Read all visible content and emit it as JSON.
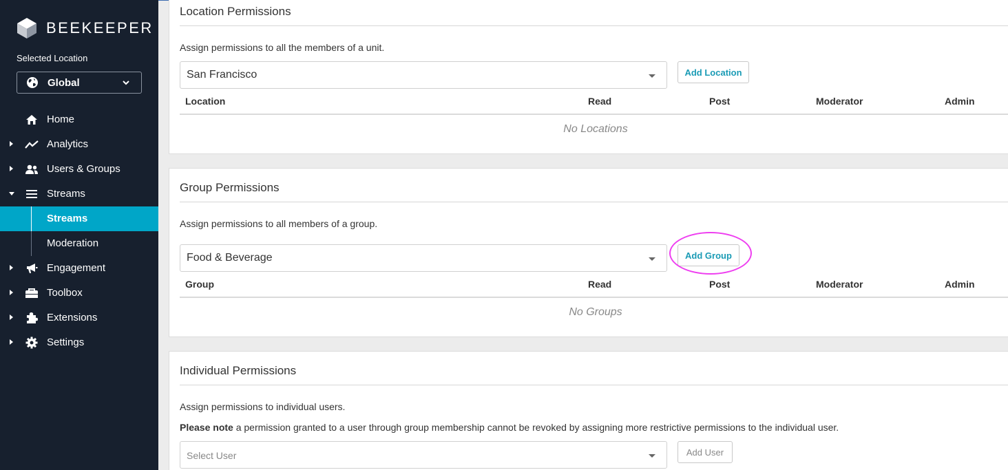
{
  "sidebar": {
    "logo_text": "BEEKEEPER",
    "selected_location_label": "Selected Location",
    "location_value": "Global",
    "nav": [
      {
        "label": "Home",
        "icon": "home-icon"
      },
      {
        "label": "Analytics",
        "icon": "analytics-icon"
      },
      {
        "label": "Users & Groups",
        "icon": "users-icon"
      },
      {
        "label": "Streams",
        "icon": "list-icon"
      },
      {
        "label": "Engagement",
        "icon": "megaphone-icon"
      },
      {
        "label": "Toolbox",
        "icon": "toolbox-icon"
      },
      {
        "label": "Extensions",
        "icon": "puzzle-icon"
      },
      {
        "label": "Settings",
        "icon": "gear-icon"
      }
    ],
    "streams_sub": [
      {
        "label": "Streams",
        "active": true
      },
      {
        "label": "Moderation",
        "active": false
      }
    ]
  },
  "location_permissions": {
    "title": "Location Permissions",
    "description": "Assign permissions to all the members of a unit.",
    "select_value": "San Francisco",
    "button": "Add Location",
    "columns": [
      "Location",
      "Read",
      "Post",
      "Moderator",
      "Admin"
    ],
    "empty_text": "No Locations"
  },
  "group_permissions": {
    "title": "Group Permissions",
    "description": "Assign permissions to all members of a group.",
    "select_value": "Food & Beverage",
    "button": "Add Group",
    "columns": [
      "Group",
      "Read",
      "Post",
      "Moderator",
      "Admin"
    ],
    "empty_text": "No Groups"
  },
  "individual_permissions": {
    "title": "Individual Permissions",
    "description": "Assign permissions to individual users.",
    "note_bold": "Please note",
    "note_text": " a permission granted to a user through group membership cannot be revoked by assigning more restrictive permissions to the individual user.",
    "select_placeholder": "Select User",
    "button": "Add User"
  },
  "colors": {
    "sidebar_bg": "#17202e",
    "accent": "#00a6c8",
    "highlight": "#ee3ef0"
  }
}
